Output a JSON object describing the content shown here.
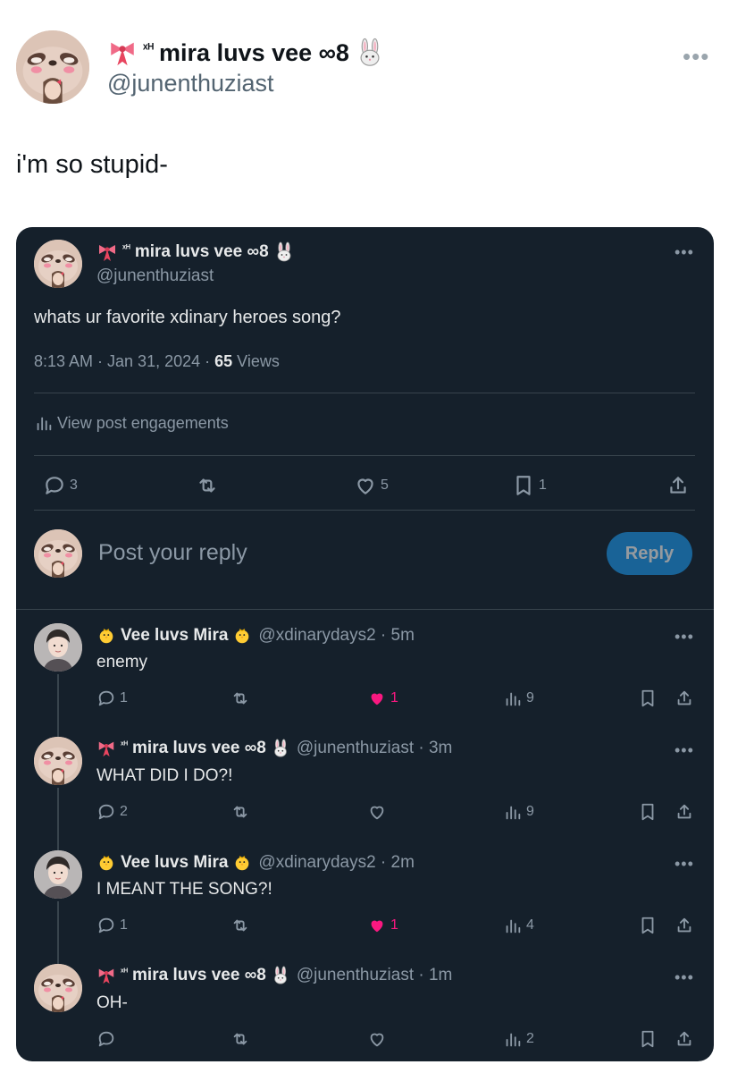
{
  "outer": {
    "name": "mira luvs vee ∞8",
    "handle": "@junenthuziast",
    "text": "i'm so stupid-"
  },
  "quoted": {
    "name": "mira luvs vee ∞8",
    "handle": "@junenthuziast",
    "text": "whats ur favorite xdinary heroes song?",
    "time": "8:13 AM · Jan 31, 2024 · ",
    "views_count": "65",
    "views_label": " Views",
    "engagements": "View post engagements",
    "actions": {
      "replies": "3",
      "likes": "5",
      "bookmarks": "1"
    }
  },
  "composer": {
    "placeholder": "Post your reply",
    "button": "Reply"
  },
  "replies": [
    {
      "name": "Vee luvs Mira",
      "meta": "@xdinarydays2 · 5m",
      "text": "enemy",
      "replies": "1",
      "likes": "1",
      "liked": true,
      "views": "9"
    },
    {
      "name": "mira luvs vee ∞8",
      "meta": "@junenthuziast · 3m",
      "text": "WHAT DID I DO?!",
      "replies": "2",
      "likes": "",
      "liked": false,
      "views": "9"
    },
    {
      "name": "Vee luvs Mira",
      "meta": "@xdinarydays2 · 2m",
      "text": "I MEANT THE SONG?!",
      "replies": "1",
      "likes": "1",
      "liked": true,
      "views": "4"
    },
    {
      "name": "mira luvs vee ∞8",
      "meta": "@junenthuziast · 1m",
      "text": "OH-",
      "replies": "",
      "likes": "",
      "liked": false,
      "views": "2"
    }
  ],
  "colors": {
    "card_bg": "#15202b",
    "like_pink": "#f91880",
    "reply_blue": "#1d9bf0",
    "divider": "#38444d"
  },
  "icons": [
    "ribbon-icon",
    "bunny-icon",
    "chick-icon",
    "reply-icon",
    "retweet-icon",
    "like-icon",
    "bookmark-icon",
    "share-icon",
    "views-icon",
    "more-icon"
  ]
}
